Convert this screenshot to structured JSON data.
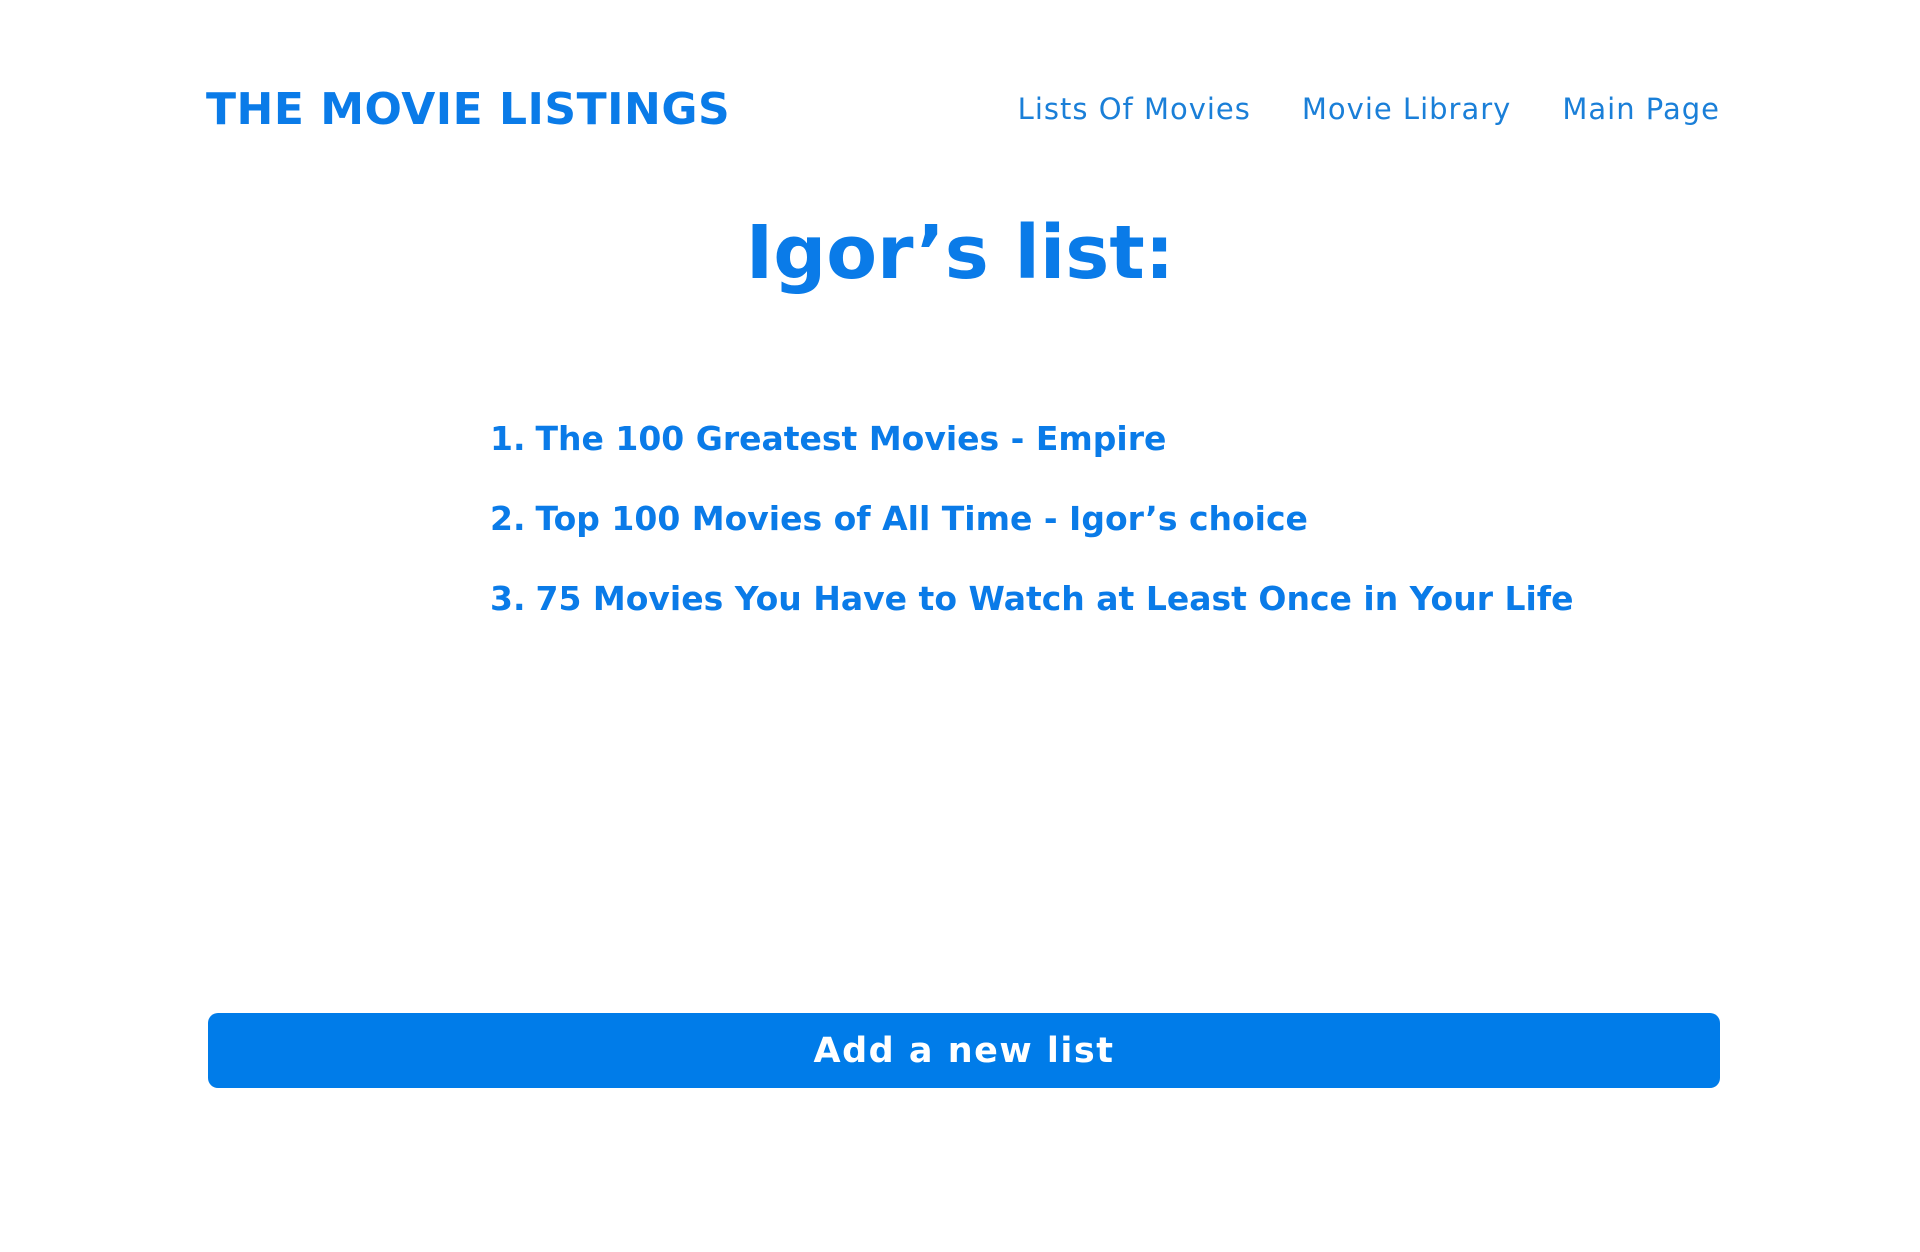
{
  "header": {
    "brand": "THE MOVIE LISTINGS",
    "nav": [
      {
        "label": "Lists Of Movies"
      },
      {
        "label": "Movie Library"
      },
      {
        "label": "Main Page"
      }
    ]
  },
  "main": {
    "title": "Igor’s list:",
    "lists": [
      {
        "number": "1.",
        "title": "The 100 Greatest Movies - Empire"
      },
      {
        "number": "2.",
        "title": "Top 100 Movies of All Time - Igor’s choice"
      },
      {
        "number": "3.",
        "title": "75 Movies You Have to Watch at Least Once in Your Life"
      }
    ],
    "add_button_label": "Add a new list"
  },
  "colors": {
    "accent": "#0a7be8",
    "button_bg": "#007ce9",
    "button_text": "#ffffff",
    "background": "#ffffff"
  }
}
